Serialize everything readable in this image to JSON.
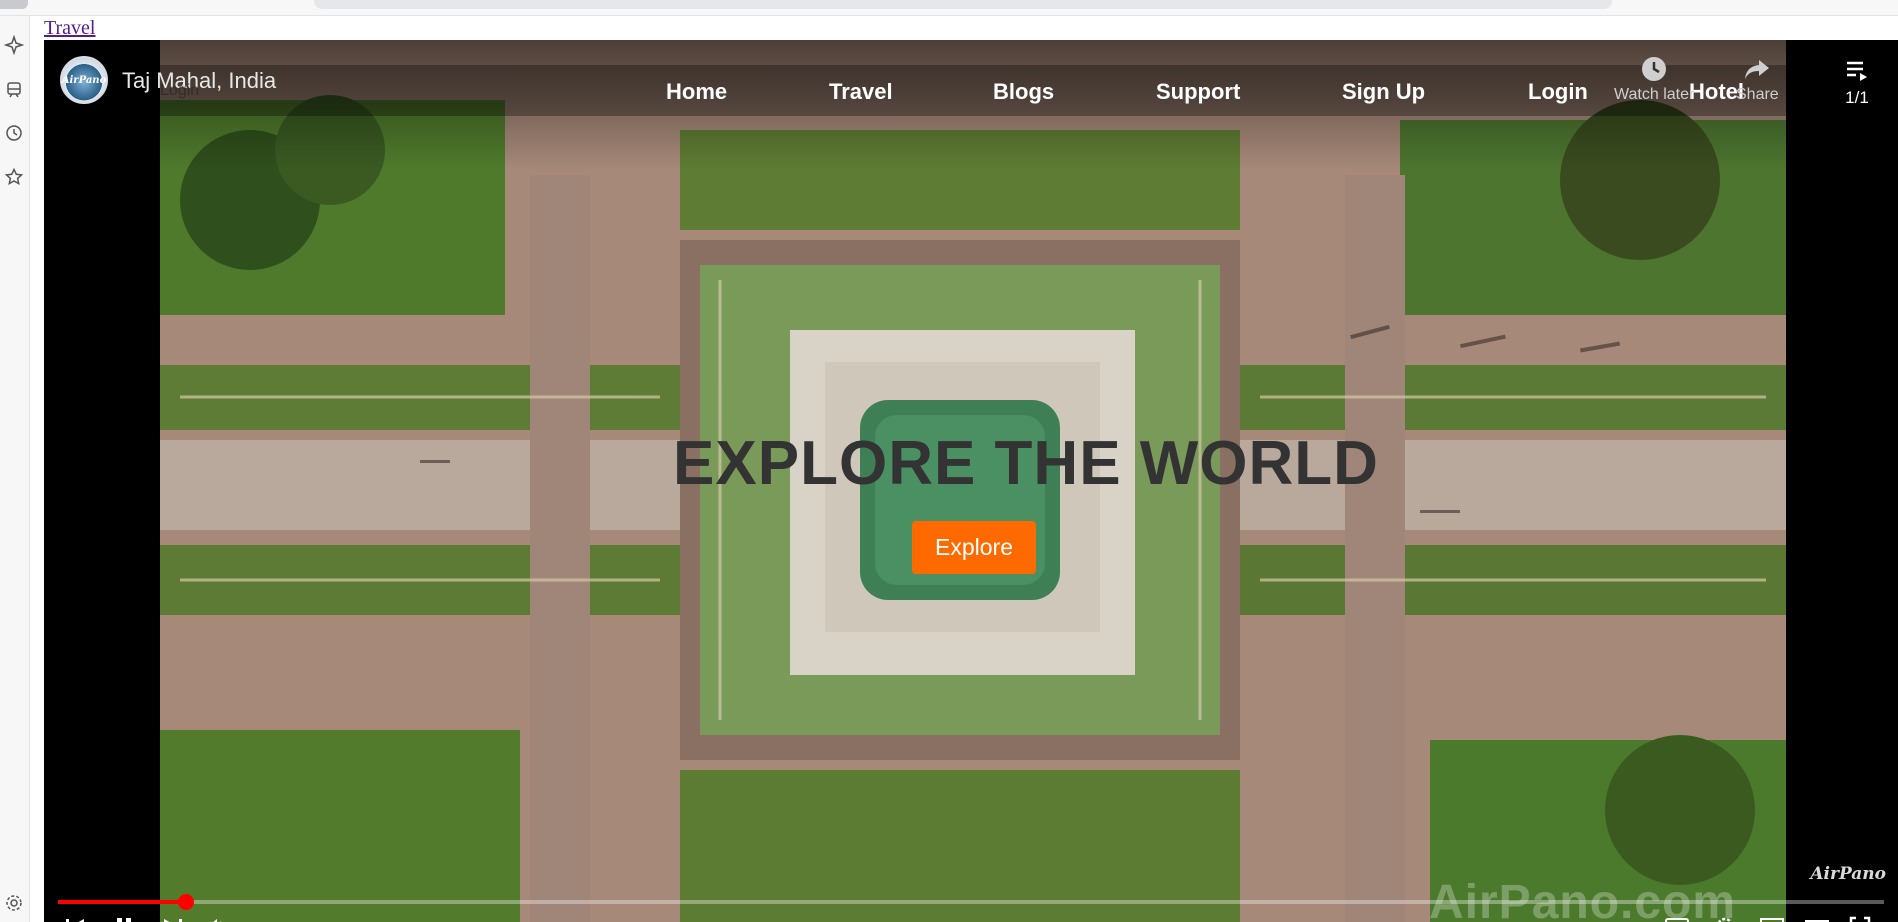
{
  "browser": {
    "link_text": "Travel"
  },
  "sidebar_icons": [
    "sparkle-pin-icon",
    "train-icon",
    "history-clock-icon",
    "star-icon",
    "settings-gear-icon"
  ],
  "video": {
    "title": "Taj Mahal, India",
    "behind_login": "Login",
    "actions": {
      "watch_later": "Watch later",
      "share": "Share"
    },
    "playlist_count": "1/1",
    "watermark_small": "AirPano",
    "watermark_large": "AirPano.com",
    "channel_avatar_text": "AirPano",
    "progress": 0.07
  },
  "site": {
    "nav": [
      {
        "label": "Home"
      },
      {
        "label": "Travel"
      },
      {
        "label": "Blogs"
      },
      {
        "label": "Support"
      },
      {
        "label": "Sign Up"
      },
      {
        "label": "Login"
      },
      {
        "label": "Hotel"
      }
    ],
    "hero": {
      "title": "EXPLORE THE WORLD",
      "button": "Explore"
    }
  },
  "colors": {
    "accent": "#ff6a00",
    "progress": "#ff0000",
    "link": "#551a8b"
  }
}
